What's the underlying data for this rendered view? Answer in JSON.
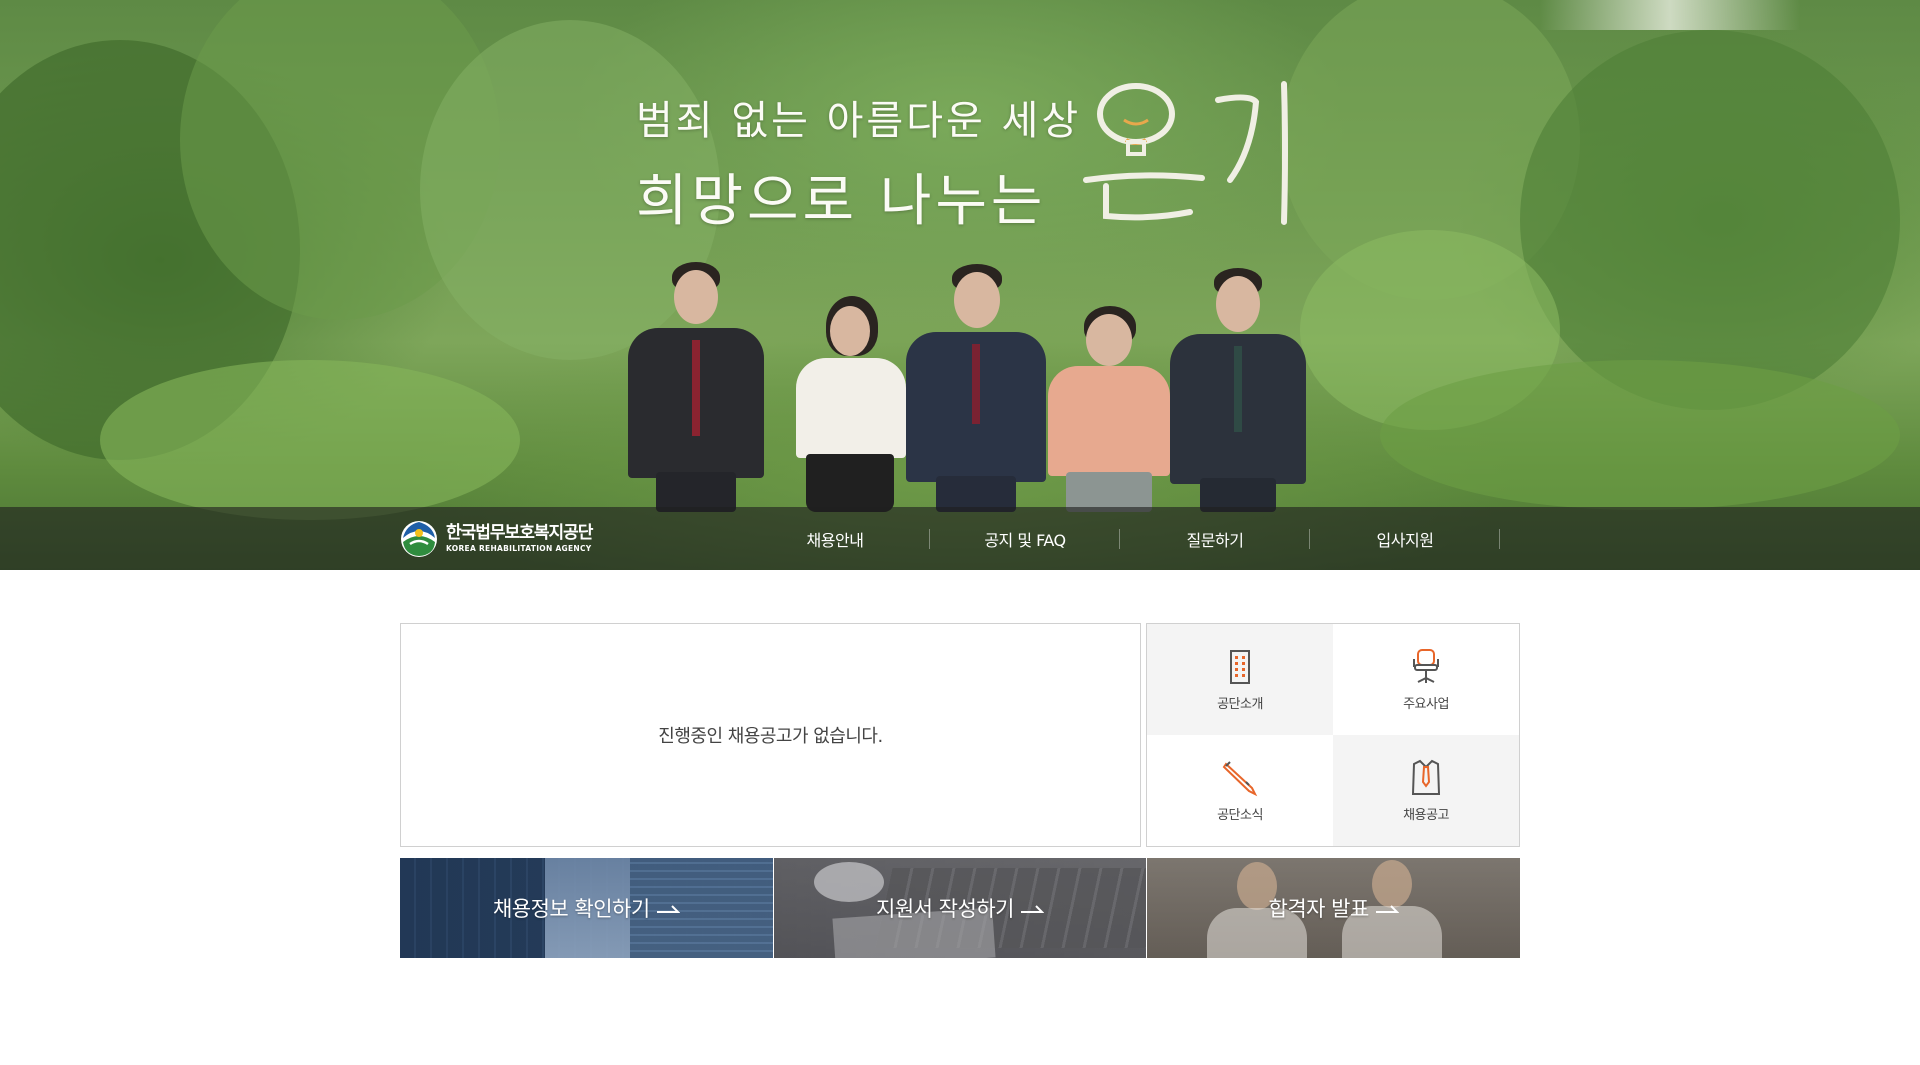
{
  "hero": {
    "slogan_line1": "범죄 없는 아름다운 세상",
    "slogan_line2": "희망으로 나누는",
    "slogan_highlight": "온기"
  },
  "header": {
    "logo_name_ko": "한국법무보호복지공단",
    "logo_name_en": "KOREA REHABILITATION AGENCY",
    "nav": [
      {
        "label": "채용안내"
      },
      {
        "label": "공지 및 FAQ"
      },
      {
        "label": "질문하기"
      },
      {
        "label": "입사지원"
      }
    ]
  },
  "notice": {
    "message": "진행중인 채용공고가 없습니다."
  },
  "quick_links": [
    {
      "label": "공단소개",
      "icon": "building-icon"
    },
    {
      "label": "주요사업",
      "icon": "office-chair-icon"
    },
    {
      "label": "공단소식",
      "icon": "pen-icon"
    },
    {
      "label": "채용공고",
      "icon": "shirt-tie-icon"
    }
  ],
  "banners": [
    {
      "label": "채용정보 확인하기"
    },
    {
      "label": "지원서 작성하기"
    },
    {
      "label": "합격자 발표"
    }
  ],
  "colors": {
    "accent_orange": "#e8662a",
    "icon_gray": "#555555",
    "nav_bg": "rgba(30,30,30,0.62)"
  }
}
